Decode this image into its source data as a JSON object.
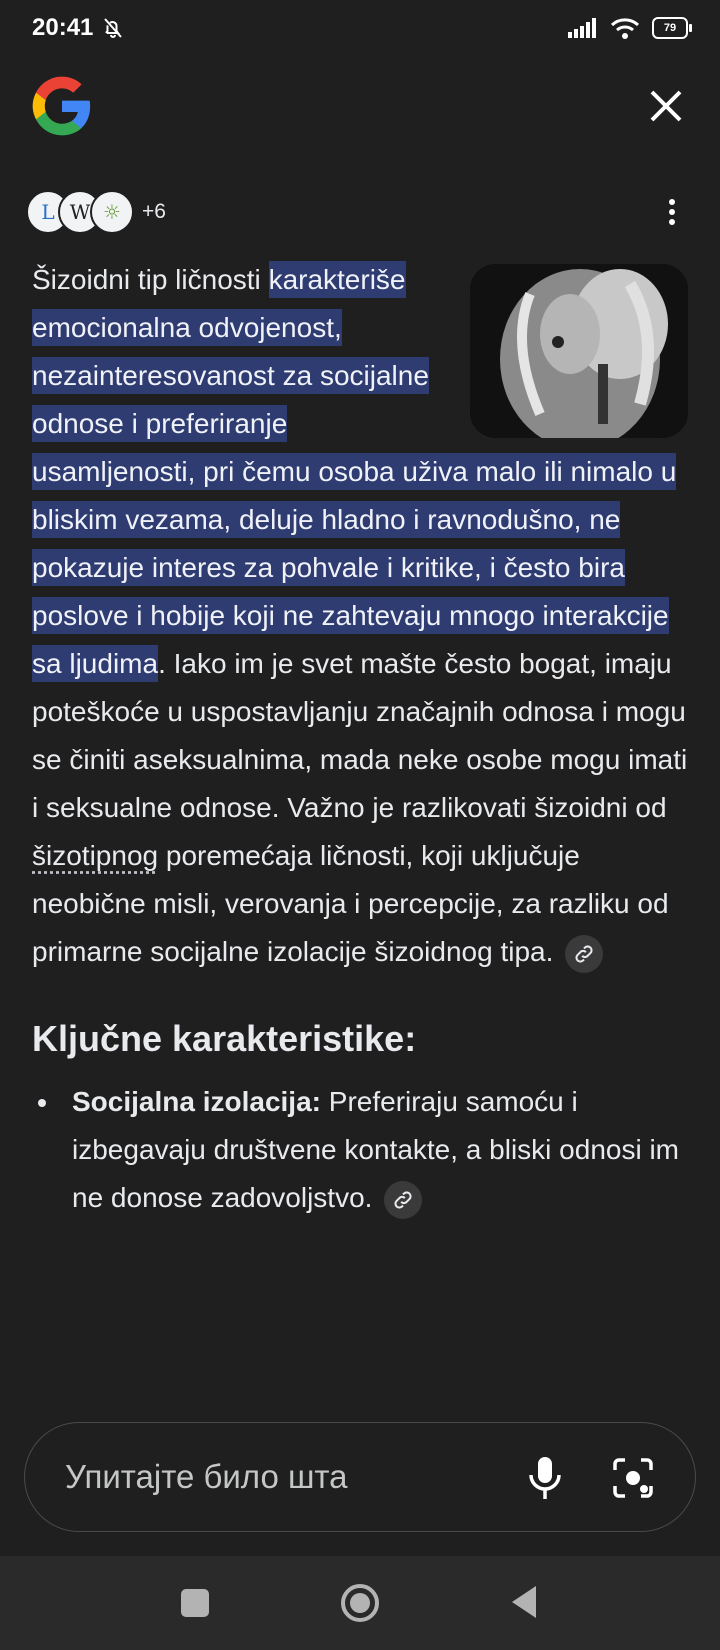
{
  "status_bar": {
    "time": "20:41",
    "battery": "79"
  },
  "header": {
    "logo": "google-g-logo",
    "close_icon": "close-icon"
  },
  "sources": {
    "icons": [
      "L",
      "W",
      "☼"
    ],
    "more_count": "+6"
  },
  "answer": {
    "lead": "Šizoidni tip ličnosti ",
    "highlighted": "karakteriše emocionalna odvojenost, nezainteresovanost za socijalne odnose i preferiranje usamljenosti, pri čemu osoba uživa malo ili nimalo u bliskim vezama, deluje hladno i ravnodušno, ne pokazuje interes za pohvale i kritike, i često bira poslove i hobije koji ne zahtevaju mnogo interakcije sa ljudima",
    "tail_before_term": ". Iako im je svet mašte često bogat, imaju poteškoće u uspostavljanju značajnih odnosa i mogu se činiti aseksualnima, mada neke osobe mogu imati i seksualne odnose. Važno je razlikovati šizoidni od ",
    "term": "šizotipnog",
    "tail_after_term": " poremećaja ličnosti, koji uključuje neobične misli, verovanja i percepcije, za razliku od primarne socijalne izolacije šizoidnog tipa."
  },
  "key_section": {
    "title": "Ključne karakteristike:",
    "items": [
      {
        "bold": "Socijalna izolacija:",
        "text": " Preferiraju samoću i izbegavaju društvene kontakte, a bliski odnosi im ne donose zadovoljstvo."
      }
    ]
  },
  "ask_bar": {
    "placeholder": "Упитајте било шта"
  },
  "colors": {
    "background": "#1f1f1f",
    "highlight": "#2e3c72",
    "text": "#e8eaed"
  },
  "icons": [
    "google-g-logo",
    "close-icon",
    "more-vert-icon",
    "link-icon",
    "mic-icon",
    "lens-icon",
    "recents-icon",
    "home-icon",
    "back-icon"
  ]
}
